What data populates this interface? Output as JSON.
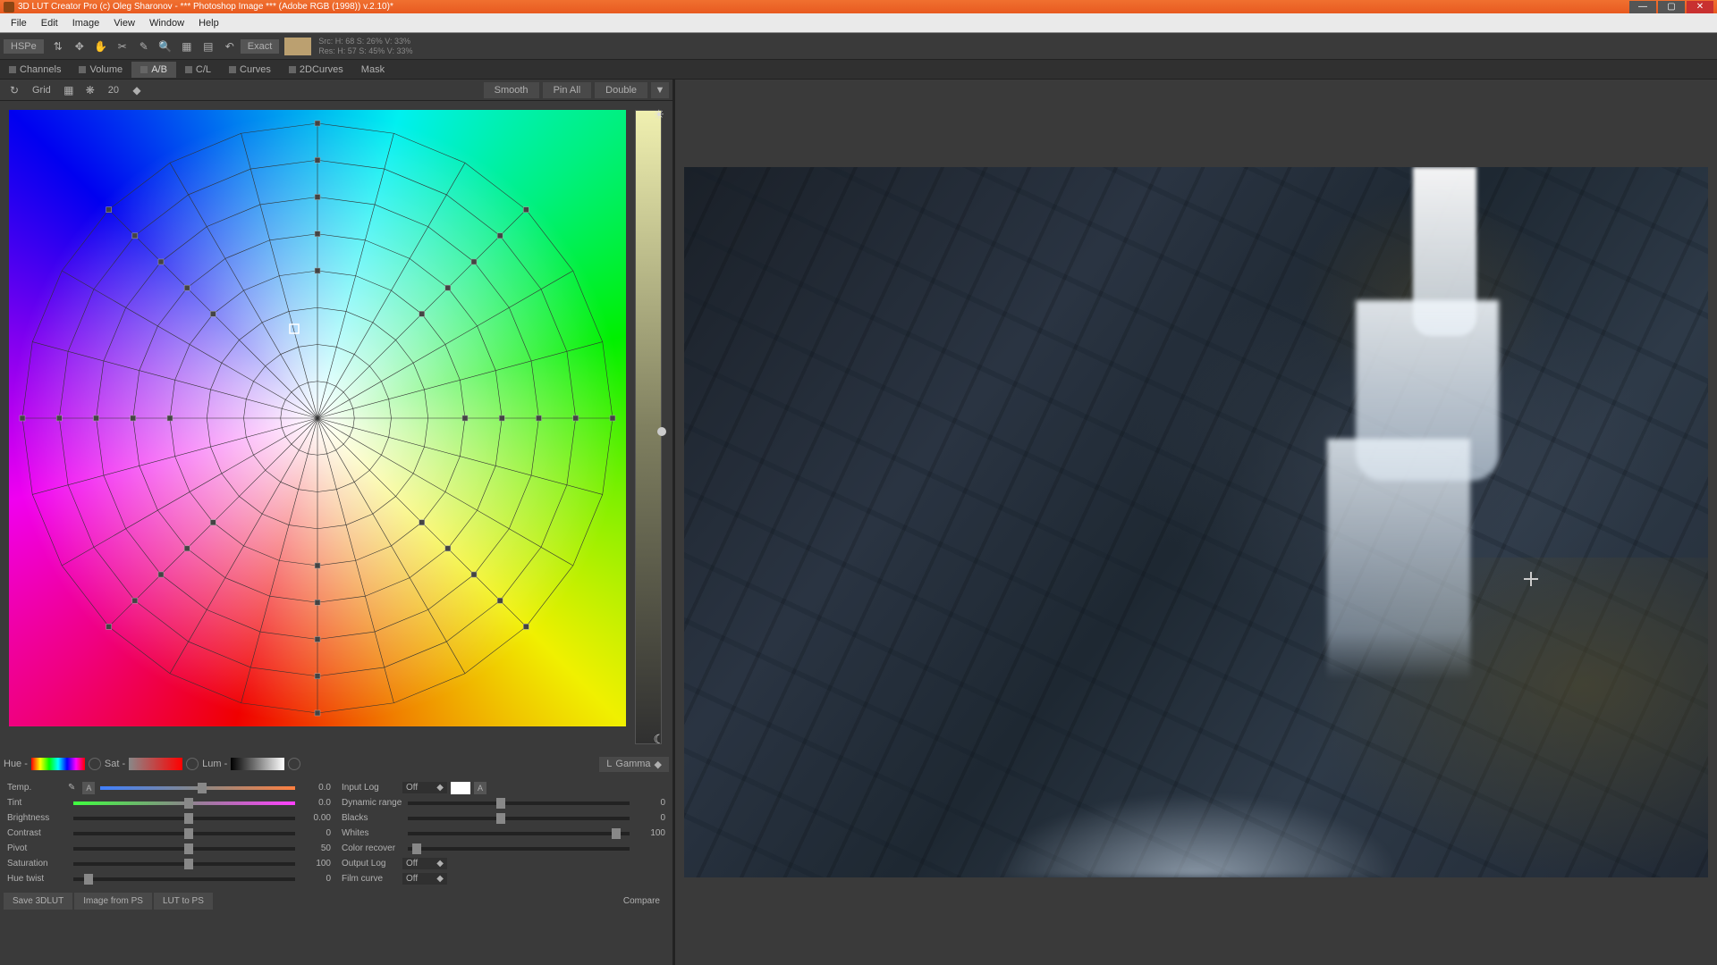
{
  "title": "3D LUT Creator Pro (c) Oleg Sharonov - *** Photoshop Image *** (Adobe RGB (1998)) v.2.10)*",
  "menu": [
    "File",
    "Edit",
    "Image",
    "View",
    "Window",
    "Help"
  ],
  "colorspace": "HSPe",
  "exactBtn": "Exact",
  "readout": {
    "line1": "Src: H:  68   S:  26%  V:  33%",
    "line2": "Res: H:  57   S:  45%  V:  33%"
  },
  "tabs": [
    "Channels",
    "Volume",
    "A/B",
    "C/L",
    "Curves",
    "2DCurves",
    "Mask"
  ],
  "activeTab": "A/B",
  "grid": {
    "label": "Grid",
    "value": "20",
    "smooth": "Smooth",
    "pin": "Pin All",
    "double": "Double"
  },
  "hsl": {
    "hue": "Hue -",
    "sat": "Sat -",
    "lum": "Lum -",
    "gammaL": "L",
    "gamma": "Gamma"
  },
  "sliders1": [
    {
      "k": "temp",
      "label": "Temp.",
      "val": "0.0",
      "pos": 50,
      "cls": "temp",
      "extra": "ab",
      "extraText": "A"
    },
    {
      "k": "tint",
      "label": "Tint",
      "val": "0.0",
      "pos": 50,
      "cls": "tint"
    },
    {
      "k": "bright",
      "label": "Brightness",
      "val": "0.00",
      "pos": 50
    },
    {
      "k": "contr",
      "label": "Contrast",
      "val": "0",
      "pos": 50
    },
    {
      "k": "pivot",
      "label": "Pivot",
      "val": "50",
      "pos": 50
    },
    {
      "k": "sat",
      "label": "Saturation",
      "val": "100",
      "pos": 50
    },
    {
      "k": "huet",
      "label": "Hue twist",
      "val": "0",
      "pos": 5
    }
  ],
  "sliders2": [
    {
      "k": "inlog",
      "label": "Input Log",
      "dd": "Off",
      "extra": "swatch",
      "abText": "A"
    },
    {
      "k": "dyn",
      "label": "Dynamic range",
      "val": "0",
      "pos": 40
    },
    {
      "k": "blk",
      "label": "Blacks",
      "val": "0",
      "pos": 40
    },
    {
      "k": "wht",
      "label": "Whites",
      "val": "100",
      "pos": 92
    },
    {
      "k": "crec",
      "label": "Color recover",
      "val": "",
      "pos": 2
    },
    {
      "k": "outlog",
      "label": "Output Log",
      "dd": "Off"
    },
    {
      "k": "film",
      "label": "Film curve",
      "dd": "Off"
    }
  ],
  "bottom": {
    "save": "Save 3DLUT",
    "fromps": "Image from PS",
    "tops": "LUT to PS",
    "compare": "Compare"
  }
}
